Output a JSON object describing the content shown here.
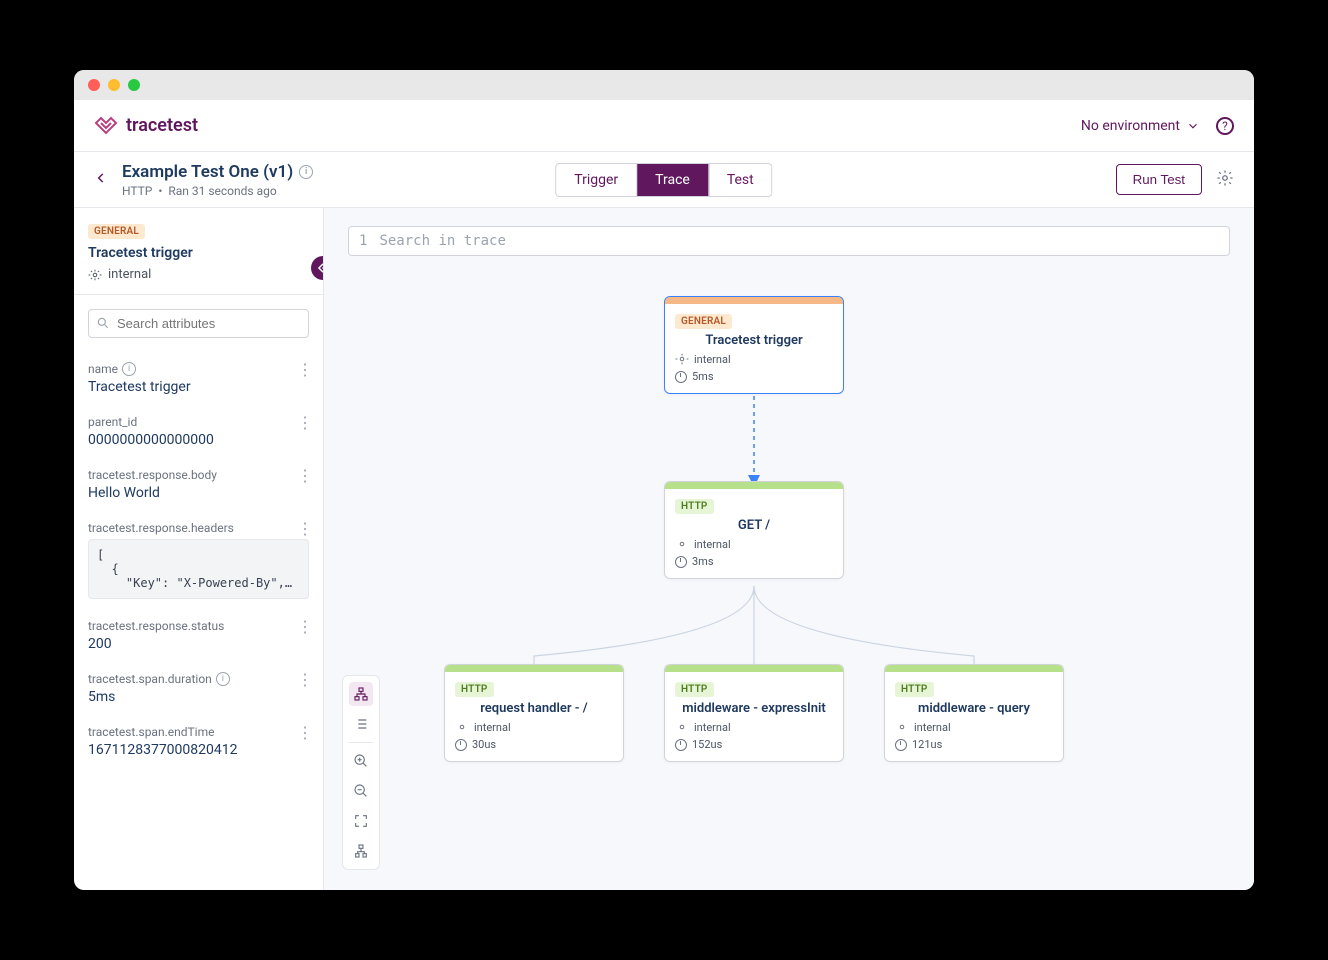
{
  "brand": "tracetest",
  "topbar": {
    "environment_label": "No environment"
  },
  "subheader": {
    "title": "Example Test One (v1)",
    "protocol": "HTTP",
    "ran": "Ran 31 seconds ago",
    "tabs": [
      "Trigger",
      "Trace",
      "Test"
    ],
    "active_tab": "Trace",
    "run_button": "Run Test"
  },
  "sidebar": {
    "badge": "GENERAL",
    "title": "Tracetest trigger",
    "kind": "internal",
    "search_placeholder": "Search attributes",
    "attributes": [
      {
        "key": "name",
        "value": "Tracetest trigger",
        "info": true
      },
      {
        "key": "parent_id",
        "value": "0000000000000000"
      },
      {
        "key": "tracetest.response.body",
        "value": "Hello World"
      },
      {
        "key": "tracetest.response.headers",
        "code": "[\n  {\n    \"Key\": \"X-Powered-By\",…"
      },
      {
        "key": "tracetest.response.status",
        "value": "200"
      },
      {
        "key": "tracetest.span.duration",
        "value": "5ms",
        "info": true
      },
      {
        "key": "tracetest.span.endTime",
        "value": "1671128377000820412"
      }
    ]
  },
  "trace": {
    "search_placeholder": "Search in trace",
    "line_no": "1",
    "nodes": {
      "root": {
        "badge": "GENERAL",
        "title": "Tracetest trigger",
        "kind": "internal",
        "dur": "5ms"
      },
      "http": {
        "badge": "HTTP",
        "title": "GET /",
        "kind": "internal",
        "dur": "3ms"
      },
      "c1": {
        "badge": "HTTP",
        "title": "request handler - /",
        "kind": "internal",
        "dur": "30us"
      },
      "c2": {
        "badge": "HTTP",
        "title": "middleware - expressInit",
        "kind": "internal",
        "dur": "152us"
      },
      "c3": {
        "badge": "HTTP",
        "title": "middleware - query",
        "kind": "internal",
        "dur": "121us"
      }
    }
  }
}
